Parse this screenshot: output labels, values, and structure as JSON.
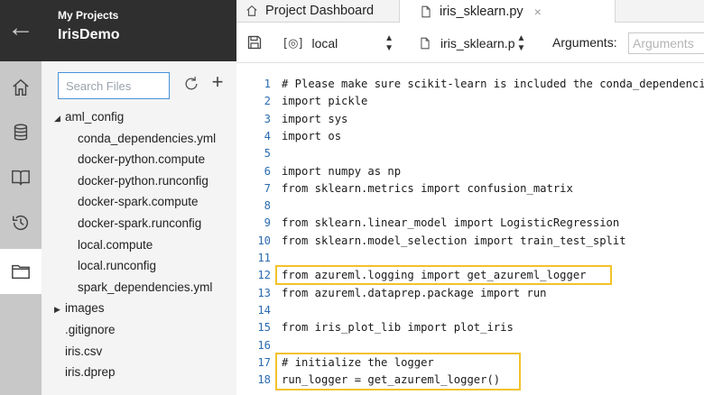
{
  "header": {
    "projects_label": "My Projects",
    "project_name": "IrisDemo"
  },
  "rail": {
    "items": [
      {
        "icon": "home-icon"
      },
      {
        "icon": "database-icon"
      },
      {
        "icon": "book-icon"
      },
      {
        "icon": "history-icon"
      },
      {
        "icon": "folder-icon",
        "active": true
      }
    ]
  },
  "files": {
    "search_placeholder": "Search Files",
    "tree": [
      {
        "label": "aml_config",
        "type": "folder",
        "expanded": true
      },
      {
        "label": "conda_dependencies.yml",
        "type": "file",
        "indent": 1
      },
      {
        "label": "docker-python.compute",
        "type": "file",
        "indent": 1
      },
      {
        "label": "docker-python.runconfig",
        "type": "file",
        "indent": 1
      },
      {
        "label": "docker-spark.compute",
        "type": "file",
        "indent": 1
      },
      {
        "label": "docker-spark.runconfig",
        "type": "file",
        "indent": 1
      },
      {
        "label": "local.compute",
        "type": "file",
        "indent": 1
      },
      {
        "label": "local.runconfig",
        "type": "file",
        "indent": 1
      },
      {
        "label": "spark_dependencies.yml",
        "type": "file",
        "indent": 1
      },
      {
        "label": "images",
        "type": "folder",
        "expanded": false
      },
      {
        "label": ".gitignore",
        "type": "file"
      },
      {
        "label": "iris.csv",
        "type": "file"
      },
      {
        "label": "iris.dprep",
        "type": "file"
      }
    ]
  },
  "tabs": {
    "dashboard": "Project Dashboard",
    "file": "iris_sklearn.py",
    "close": "×"
  },
  "toolbar": {
    "target": "local",
    "script": "iris_sklearn.p",
    "arguments_label": "Arguments:",
    "arguments_placeholder": "Arguments"
  },
  "code": {
    "lines": [
      {
        "n": "1",
        "text": "# Please make sure scikit-learn is included the conda_dependencies.yml file."
      },
      {
        "n": "2",
        "text": "import pickle"
      },
      {
        "n": "3",
        "text": "import sys"
      },
      {
        "n": "4",
        "text": "import os"
      },
      {
        "n": "5",
        "text": ""
      },
      {
        "n": "6",
        "text": "import numpy as np"
      },
      {
        "n": "7",
        "text": "from sklearn.metrics import confusion_matrix"
      },
      {
        "n": "8",
        "text": ""
      },
      {
        "n": "9",
        "text": "from sklearn.linear_model import LogisticRegression"
      },
      {
        "n": "10",
        "text": "from sklearn.model_selection import train_test_split"
      },
      {
        "n": "11",
        "text": ""
      },
      {
        "n": "12",
        "text": "from azureml.logging import get_azureml_logger"
      },
      {
        "n": "13",
        "text": "from azureml.dataprep.package import run"
      },
      {
        "n": "14",
        "text": ""
      },
      {
        "n": "15",
        "text": "from iris_plot_lib import plot_iris"
      },
      {
        "n": "16",
        "text": ""
      },
      {
        "n": "17",
        "text": "# initialize the logger"
      },
      {
        "n": "18",
        "text": "run_logger = get_azureml_logger()"
      }
    ]
  }
}
